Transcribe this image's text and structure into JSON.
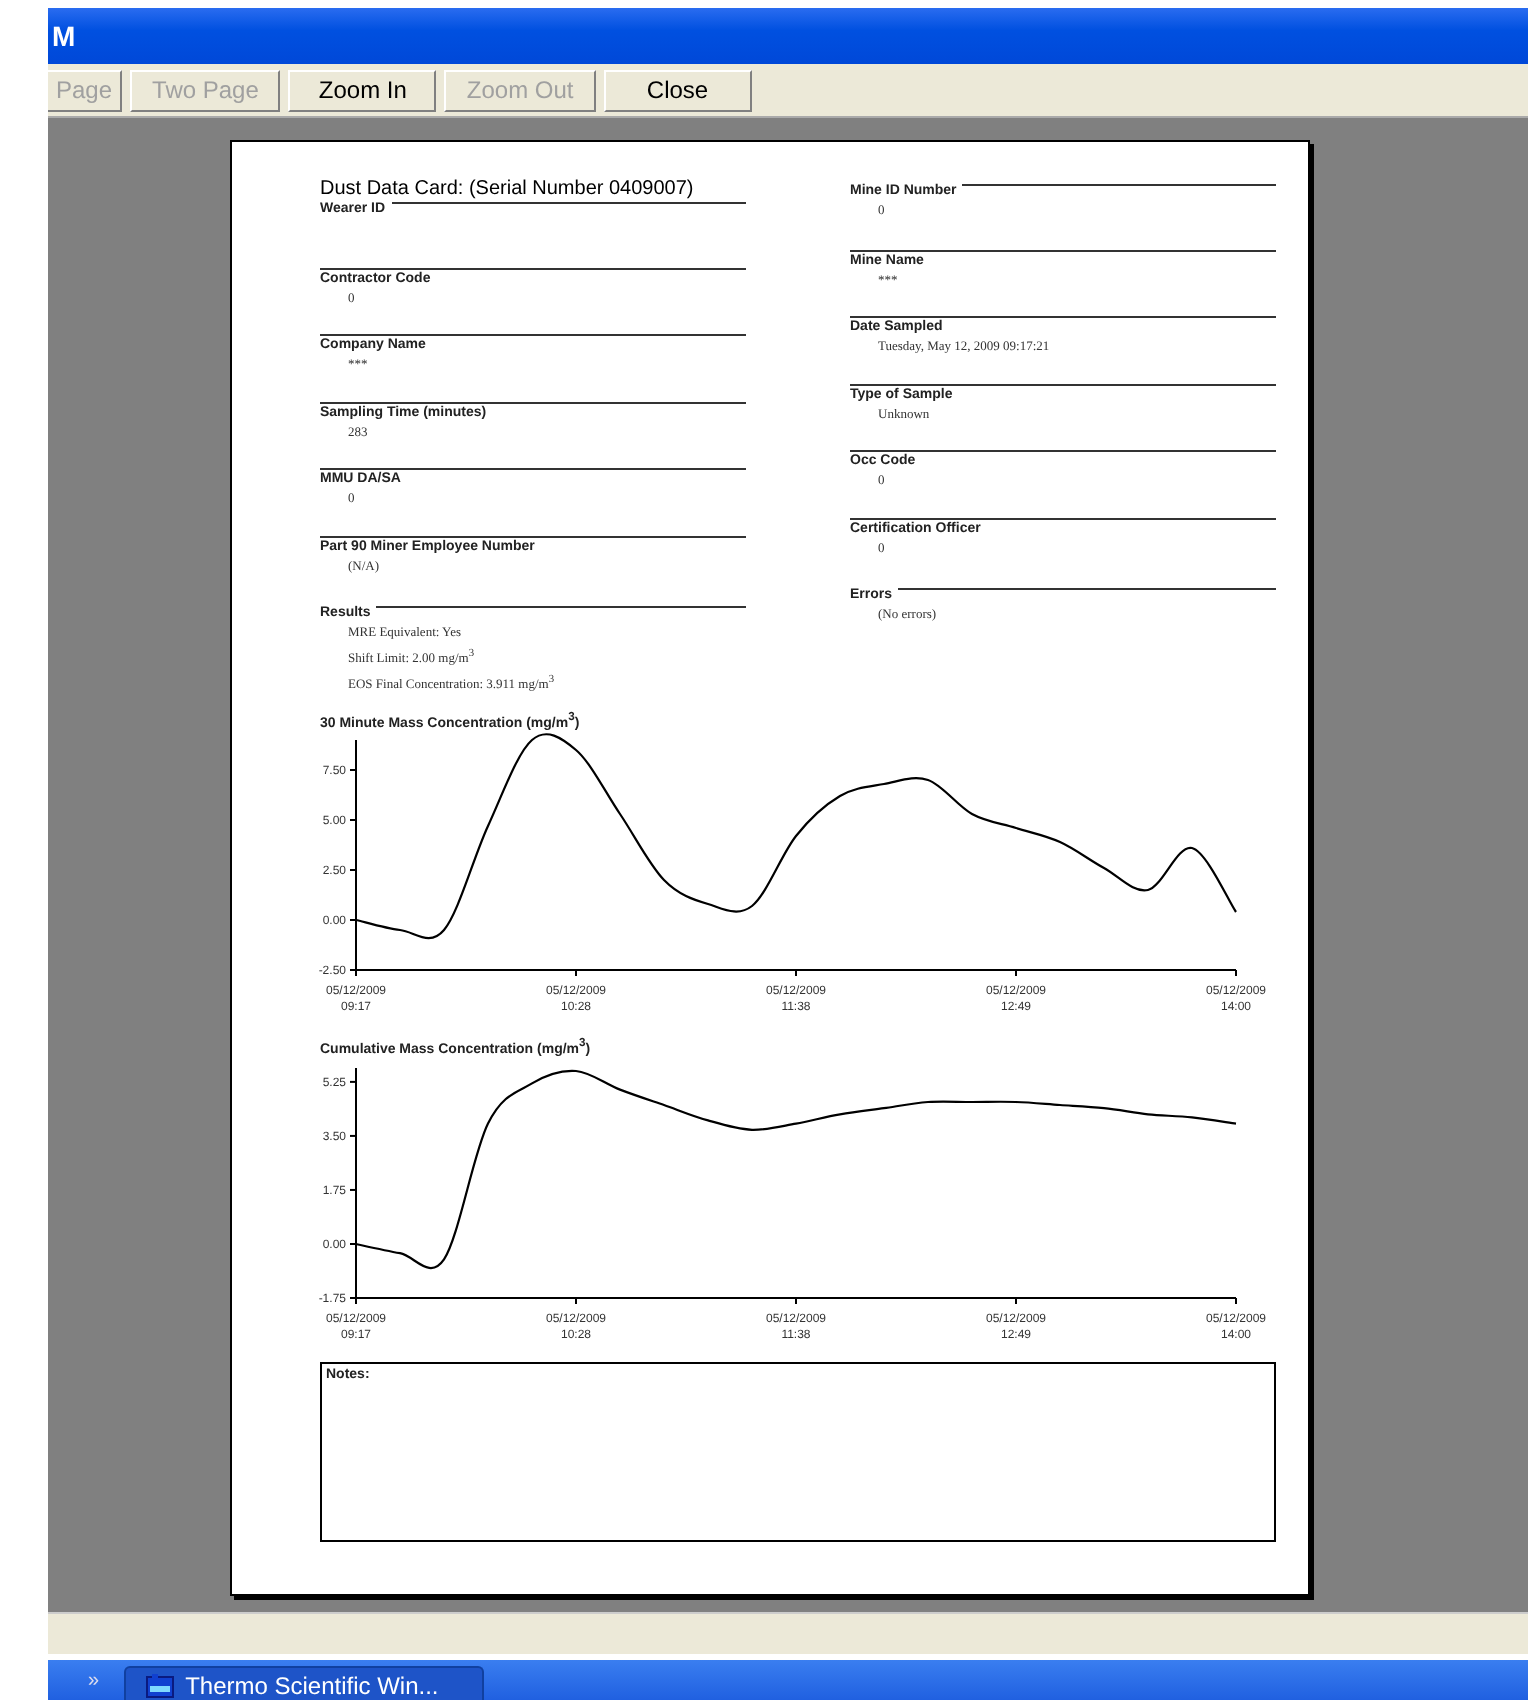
{
  "window": {
    "title": "M"
  },
  "toolbar": [
    {
      "label": "Page",
      "disabled": true
    },
    {
      "label": "Two Page",
      "disabled": true
    },
    {
      "label": "Zoom In",
      "disabled": false
    },
    {
      "label": "Zoom Out",
      "disabled": true
    },
    {
      "label": "Close",
      "disabled": false
    }
  ],
  "card": {
    "title": "Dust Data Card:  (Serial Number  0409007)",
    "left_fields": [
      {
        "kind": "inline",
        "label": "Wearer ID"
      },
      {
        "kind": "top",
        "label": "Contractor Code",
        "values": [
          "0"
        ]
      },
      {
        "kind": "top",
        "label": "Company Name",
        "values": [
          "***"
        ]
      },
      {
        "kind": "top",
        "label": "Sampling Time (minutes)",
        "values": [
          "283"
        ]
      },
      {
        "kind": "top",
        "label": "MMU DA/SA",
        "values": [
          "0"
        ]
      },
      {
        "kind": "top",
        "label": "Part 90 Miner Employee Number",
        "values": [
          "(N/A)"
        ]
      },
      {
        "kind": "inline",
        "label": "Results",
        "values": [
          "MRE Equivalent: Yes",
          "Shift Limit: 2.00 mg/m$^{3}$",
          "EOS Final Concentration: 3.911 mg/m$^{3}$"
        ]
      }
    ],
    "right_fields": [
      {
        "kind": "inline",
        "label": "Mine ID Number",
        "values": [
          "0"
        ]
      },
      {
        "kind": "top",
        "label": "Mine Name",
        "values": [
          "***"
        ]
      },
      {
        "kind": "top",
        "label": "Date Sampled",
        "values": [
          "Tuesday, May 12, 2009 09:17:21"
        ]
      },
      {
        "kind": "top",
        "label": "Type of Sample",
        "values": [
          "Unknown"
        ]
      },
      {
        "kind": "top",
        "label": "Occ Code",
        "values": [
          "0"
        ]
      },
      {
        "kind": "top",
        "label": "Certification Officer",
        "values": [
          "0"
        ]
      },
      {
        "kind": "inline",
        "label": "Errors",
        "values": [
          "(No errors)"
        ]
      }
    ],
    "charts": [
      {
        "chart_data": {
          "type": "line",
          "title": "30 Minute Mass Concentration (mg/m$^{3}$)",
          "categories": [
            "05/12/2009 09:17",
            null,
            null,
            null,
            null,
            "05/12/2009 10:28",
            null,
            null,
            null,
            null,
            "05/12/2009 11:38",
            null,
            null,
            null,
            null,
            "05/12/2009 12:49",
            null,
            null,
            null,
            null,
            "05/12/2009 14:00"
          ],
          "series": [
            {
              "color": "#000000",
              "values": [
                0,
                -0.5,
                -0.5,
                4.7,
                9.0,
                8.5,
                5.3,
                2.0,
                0.8,
                0.7,
                4.2,
                6.2,
                6.8,
                7.0,
                5.3,
                4.6,
                3.9,
                2.6,
                1.5,
                3.6,
                0.4
              ]
            }
          ],
          "ylim": [
            -2.5,
            9.0
          ],
          "yticks": [
            {
              "value": -2.5,
              "label": "-2.50"
            },
            {
              "value": 0,
              "label": "0.00"
            },
            {
              "value": 2.5,
              "label": "2.50"
            },
            {
              "value": 5,
              "label": "5.00"
            },
            {
              "value": 7.5,
              "label": "7.50"
            }
          ]
        }
      },
      {
        "chart_data": {
          "type": "line",
          "title": "Cumulative Mass Concentration (mg/m$^{3}$)",
          "categories": [
            "05/12/2009 09:17",
            null,
            null,
            null,
            null,
            "05/12/2009 10:28",
            null,
            null,
            null,
            null,
            "05/12/2009 11:38",
            null,
            null,
            null,
            null,
            "05/12/2009 12:49",
            null,
            null,
            null,
            null,
            "05/12/2009 14:00"
          ],
          "series": [
            {
              "color": "#000000",
              "values": [
                0,
                -0.3,
                -0.5,
                3.9,
                5.2,
                5.6,
                5.0,
                4.5,
                4.0,
                3.7,
                3.9,
                4.2,
                4.4,
                4.6,
                4.6,
                4.6,
                4.5,
                4.4,
                4.2,
                4.1,
                3.9
              ]
            }
          ],
          "ylim": [
            -1.75,
            5.7
          ],
          "yticks": [
            {
              "value": -1.75,
              "label": "-1.75"
            },
            {
              "value": 0,
              "label": "0.00"
            },
            {
              "value": 1.75,
              "label": "1.75"
            },
            {
              "value": 3.5,
              "label": "3.50"
            },
            {
              "value": 5.25,
              "label": "5.25"
            }
          ]
        }
      }
    ],
    "notes": {
      "label": "Notes:"
    }
  },
  "taskbar": {
    "expander": "»",
    "task": "Thermo Scientific Win..."
  }
}
